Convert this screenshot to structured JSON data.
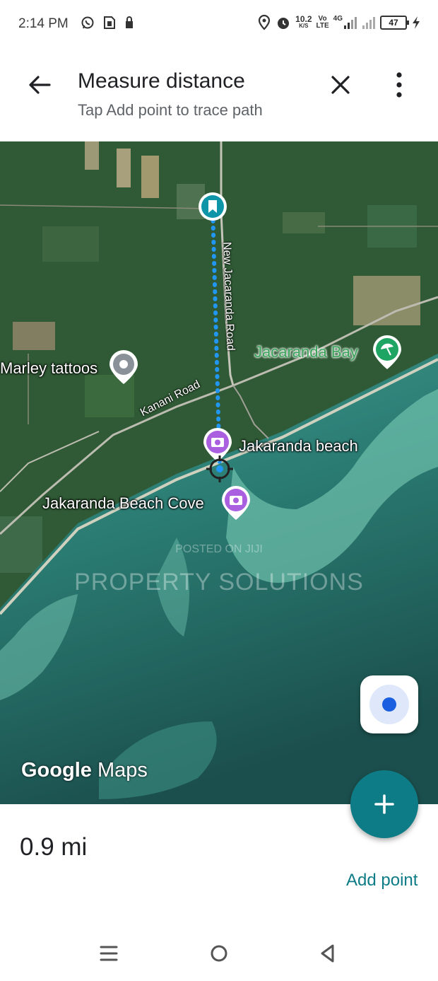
{
  "status_bar": {
    "time": "2:14 PM",
    "net_speed_value": "10.2",
    "net_speed_unit": "K/S",
    "volte_top": "Vo",
    "volte_bottom": "LTE",
    "network_type": "4G",
    "battery": "47",
    "icons": [
      "whatsapp-icon",
      "sim-icon",
      "lock-icon",
      "location-icon",
      "alarm-icon",
      "signal-icon",
      "signal-icon",
      "battery-icon",
      "charging-icon"
    ]
  },
  "header": {
    "title": "Measure distance",
    "subtitle": "Tap Add point to trace path"
  },
  "map": {
    "places": {
      "marley": "Marley tattoos",
      "jacaranda_bay": "Jacaranda Bay",
      "jakaranda_beach": "Jakaranda beach",
      "beach_cove": "Jakaranda Beach Cove"
    },
    "roads": {
      "new_jacaranda": "New Jacaranda Road",
      "kanani": "Kanani Road"
    },
    "watermark_line1": "POSTED ON JIJI",
    "watermark_line2": "PROPERTY SOLUTIONS",
    "logo_word1": "Google",
    "logo_word2": "Maps"
  },
  "measurement": {
    "distance": "0.9 mi",
    "add_point_label": "Add point"
  },
  "colors": {
    "accent": "#0e7c86",
    "path": "#2196f3",
    "poi_purple": "#a95fe0",
    "bay_green": "#3aa35a"
  }
}
